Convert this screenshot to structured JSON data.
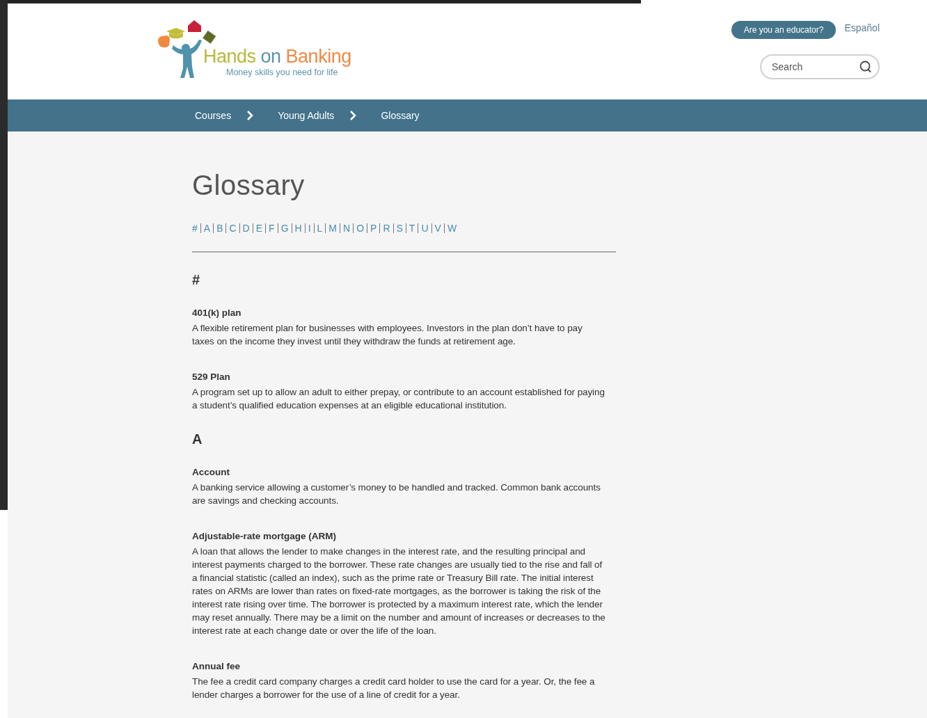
{
  "header": {
    "logo": {
      "words": [
        {
          "text": "Hands",
          "color": "#b7b93b"
        },
        {
          "text": "on",
          "color": "#5b93ad"
        },
        {
          "text": "Banking",
          "color": "#ef8a45"
        }
      ],
      "tagline": "Money skills you need for life"
    },
    "educator_button": "Are you an educator?",
    "language_link": "Español",
    "search": {
      "placeholder": "Search"
    }
  },
  "breadcrumb": [
    "Courses",
    "Young Adults",
    "Glossary"
  ],
  "title": "Glossary",
  "letter_index": [
    "#",
    "A",
    "B",
    "C",
    "D",
    "E",
    "F",
    "G",
    "H",
    "I",
    "L",
    "M",
    "N",
    "O",
    "P",
    "R",
    "S",
    "T",
    "U",
    "V",
    "W"
  ],
  "sections": [
    {
      "heading": "#",
      "terms": [
        {
          "term": "401(k) plan",
          "definition": "A flexible retirement plan for businesses with employees. Investors in the plan don’t have to pay taxes on the income they invest until they withdraw the funds at retirement age."
        },
        {
          "term": "529 Plan",
          "definition": "A program set up to allow an adult to either prepay, or contribute to an account established for paying a student’s qualified education expenses at an eligible educational institution."
        }
      ]
    },
    {
      "heading": "A",
      "terms": [
        {
          "term": "Account",
          "definition": "A banking service allowing a customer’s money to be handled and tracked. Common bank accounts are savings and checking accounts."
        },
        {
          "term": "Adjustable-rate mortgage (ARM)",
          "definition": "A loan that allows the lender to make changes in the interest rate, and the resulting principal and interest payments charged to the borrower. These rate changes are usually tied to the rise and fall of a financial statistic (called an index), such as the prime rate or Treasury Bill rate. The initial interest rates on ARMs are lower than rates on fixed-rate mortgages, as the borrower is taking the risk of the interest rate rising over time. The borrower is protected by a maximum interest rate, which the lender may reset annually. There may be a limit on the number and amount of increases or decreases to the interest rate at each change date or over the life of the loan."
        },
        {
          "term": "Annual fee",
          "definition": "The fee a credit card company charges a credit card holder to use the card for a year. Or, the fee a lender charges a borrower for the use of a line of credit for a year."
        }
      ]
    }
  ]
}
